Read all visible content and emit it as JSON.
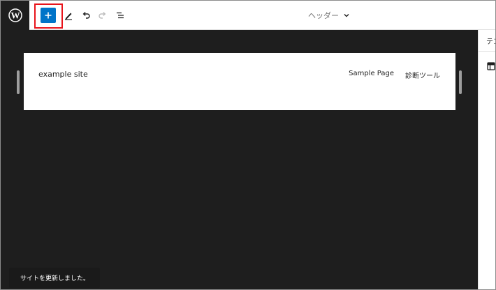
{
  "toolbar": {
    "document_title": "ヘッダー"
  },
  "canvas": {
    "site_title": "example site",
    "nav_items": [
      "Sample Page",
      "診断ツール"
    ]
  },
  "snackbar": {
    "message": "サイトを更新しました。"
  },
  "sidebar": {
    "tab_label": "テンプレート"
  },
  "colors": {
    "accent": "#0074c8",
    "highlight": "#e8141b",
    "canvas_bg": "#1e1e1e"
  },
  "icons": [
    "wordpress-logo-icon",
    "plus-icon",
    "pencil-icon",
    "undo-icon",
    "redo-icon",
    "list-view-icon",
    "chevron-down-icon",
    "template-part-icon"
  ]
}
